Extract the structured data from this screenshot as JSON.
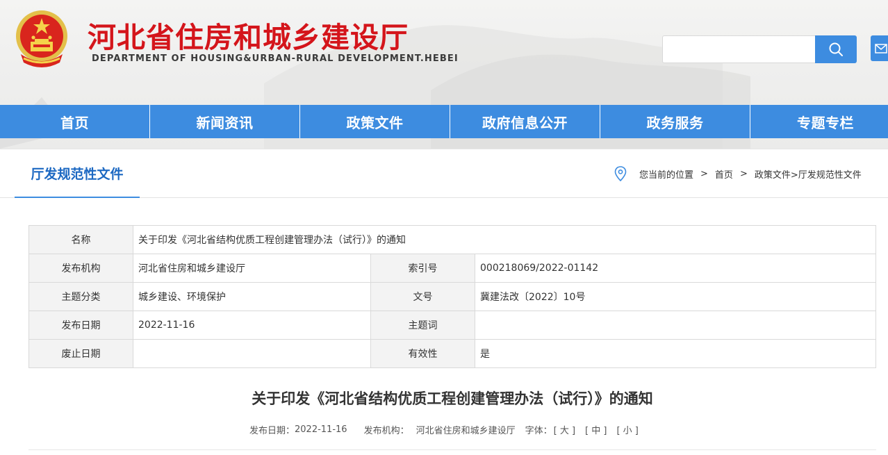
{
  "header": {
    "title": "河北省住房和城乡建设厅",
    "subtitle": "DEPARTMENT OF HOUSING&URBAN-RURAL DEVELOPMENT.HEBEI",
    "search_placeholder": "",
    "colors": {
      "brand_red": "#d4151b",
      "accent_blue": "#3d8ce0"
    }
  },
  "nav": [
    {
      "label": "首页"
    },
    {
      "label": "新闻资讯"
    },
    {
      "label": "政策文件"
    },
    {
      "label": "政府信息公开"
    },
    {
      "label": "政务服务"
    },
    {
      "label": "专题专栏"
    }
  ],
  "section": {
    "title": "厅发规范性文件",
    "breadcrumb": {
      "prefix": "您当前的位置",
      "sep1": ">",
      "home": "首页",
      "sep2": ">",
      "path": "政策文件>厅发规范性文件"
    }
  },
  "info": {
    "name_label": "名称",
    "name_value": "关于印发《河北省结构优质工程创建管理办法（试行）》的通知",
    "publisher_label": "发布机构",
    "publisher_value": "河北省住房和城乡建设厅",
    "index_label": "索引号",
    "index_value": "000218069/2022-01142",
    "category_label": "主题分类",
    "category_value": "城乡建设、环境保护",
    "docno_label": "文号",
    "docno_value": "冀建法改〔2022〕10号",
    "date_label": "发布日期",
    "date_value": "2022-11-16",
    "keywords_label": "主题词",
    "keywords_value": "",
    "expire_label": "废止日期",
    "expire_value": "",
    "valid_label": "有效性",
    "valid_value": "是"
  },
  "article": {
    "title": "关于印发《河北省结构优质工程创建管理办法（试行）》的通知",
    "date_label": "发布日期：",
    "date_value": "2022-11-16",
    "publisher_label": "发布机构：",
    "publisher_value": "河北省住房和城乡建设厅",
    "fontsize_label": "字体：",
    "font_large": "[ 大 ]",
    "font_medium": "[ 中 ]",
    "font_small": "[ 小 ]"
  },
  "icons": [
    "national-emblem-icon",
    "search-icon",
    "location-pin-icon",
    "side-tab-icon"
  ]
}
